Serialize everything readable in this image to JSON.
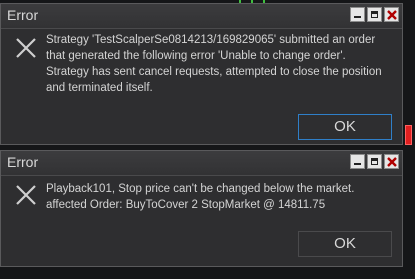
{
  "dialogs": [
    {
      "title": "Error",
      "message": "Strategy 'TestScalperSe0814213/169829065' submitted an order that generated the following error 'Unable to change order'. Strategy has sent cancel requests, attempted to close the position and terminated itself.",
      "ok_label": "OK"
    },
    {
      "title": "Error",
      "message": "Playback101, Stop price can't be changed below the market. affected Order: BuyToCover 2 StopMarket @ 14811.75",
      "ok_label": "OK"
    }
  ],
  "colors": {
    "background": "#151618",
    "dialog": "#2e2e30",
    "focus_border": "#2f7fc8",
    "chart_red": "#e02020",
    "chart_green": "#3fbf3f"
  },
  "icons": [
    "error-x-icon",
    "minimize-icon",
    "maximize-icon",
    "close-icon"
  ]
}
